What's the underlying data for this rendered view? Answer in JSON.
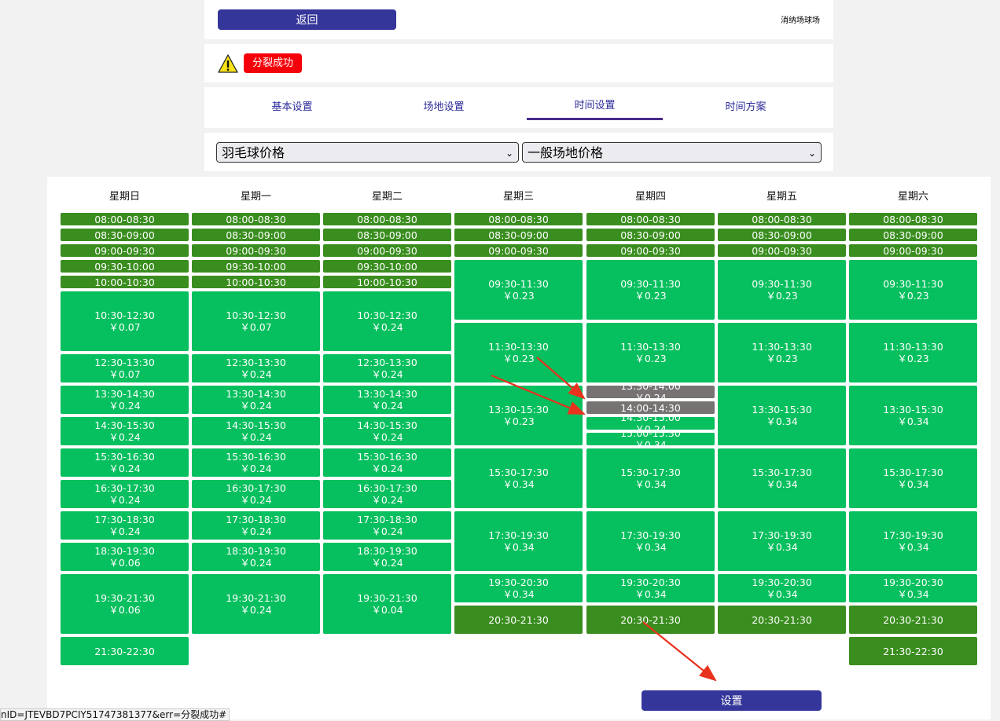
{
  "topbar": {
    "back_label": "返回",
    "venue_name": "消纳场球场"
  },
  "alert": {
    "icon": "warning-icon",
    "message": "分裂成功"
  },
  "tabs": [
    {
      "label": "基本设置",
      "active": false
    },
    {
      "label": "场地设置",
      "active": false
    },
    {
      "label": "时间设置",
      "active": true
    },
    {
      "label": "时间方案",
      "active": false
    }
  ],
  "filters": {
    "sport_select": "羽毛球价格",
    "price_type_select": "一般场地价格"
  },
  "days": [
    {
      "name": "星期日",
      "slots": [
        {
          "time": "08:00-08:30",
          "price": "",
          "style": "dark"
        },
        {
          "time": "08:30-09:00",
          "price": "",
          "style": "dark"
        },
        {
          "time": "09:00-09:30",
          "price": "",
          "style": "dark"
        },
        {
          "time": "09:30-10:00",
          "price": "",
          "style": "dark"
        },
        {
          "time": "10:00-10:30",
          "price": "",
          "style": "dark"
        },
        {
          "time": "10:30-12:30",
          "price": "￥0.07",
          "style": "light"
        },
        {
          "time": "12:30-13:30",
          "price": "￥0.07",
          "style": "light"
        },
        {
          "time": "13:30-14:30",
          "price": "￥0.24",
          "style": "light"
        },
        {
          "time": "14:30-15:30",
          "price": "￥0.24",
          "style": "light"
        },
        {
          "time": "15:30-16:30",
          "price": "￥0.24",
          "style": "light"
        },
        {
          "time": "16:30-17:30",
          "price": "￥0.24",
          "style": "light"
        },
        {
          "time": "17:30-18:30",
          "price": "￥0.24",
          "style": "light"
        },
        {
          "time": "18:30-19:30",
          "price": "￥0.06",
          "style": "light"
        },
        {
          "time": "19:30-21:30",
          "price": "￥0.06",
          "style": "light"
        },
        {
          "time": "21:30-22:30",
          "price": "",
          "style": "light"
        }
      ]
    },
    {
      "name": "星期一",
      "slots": [
        {
          "time": "08:00-08:30",
          "price": "",
          "style": "dark"
        },
        {
          "time": "08:30-09:00",
          "price": "",
          "style": "dark"
        },
        {
          "time": "09:00-09:30",
          "price": "",
          "style": "dark"
        },
        {
          "time": "09:30-10:00",
          "price": "",
          "style": "dark"
        },
        {
          "time": "10:00-10:30",
          "price": "",
          "style": "dark"
        },
        {
          "time": "10:30-12:30",
          "price": "￥0.07",
          "style": "light"
        },
        {
          "time": "12:30-13:30",
          "price": "￥0.24",
          "style": "light"
        },
        {
          "time": "13:30-14:30",
          "price": "￥0.24",
          "style": "light"
        },
        {
          "time": "14:30-15:30",
          "price": "￥0.24",
          "style": "light"
        },
        {
          "time": "15:30-16:30",
          "price": "￥0.24",
          "style": "light"
        },
        {
          "time": "16:30-17:30",
          "price": "￥0.24",
          "style": "light"
        },
        {
          "time": "17:30-18:30",
          "price": "￥0.24",
          "style": "light"
        },
        {
          "time": "18:30-19:30",
          "price": "￥0.24",
          "style": "light"
        },
        {
          "time": "19:30-21:30",
          "price": "￥0.24",
          "style": "light"
        }
      ]
    },
    {
      "name": "星期二",
      "slots": [
        {
          "time": "08:00-08:30",
          "price": "",
          "style": "dark"
        },
        {
          "time": "08:30-09:00",
          "price": "",
          "style": "dark"
        },
        {
          "time": "09:00-09:30",
          "price": "",
          "style": "dark"
        },
        {
          "time": "09:30-10:00",
          "price": "",
          "style": "dark"
        },
        {
          "time": "10:00-10:30",
          "price": "",
          "style": "dark"
        },
        {
          "time": "10:30-12:30",
          "price": "￥0.24",
          "style": "light"
        },
        {
          "time": "12:30-13:30",
          "price": "￥0.24",
          "style": "light"
        },
        {
          "time": "13:30-14:30",
          "price": "￥0.24",
          "style": "light"
        },
        {
          "time": "14:30-15:30",
          "price": "￥0.24",
          "style": "light"
        },
        {
          "time": "15:30-16:30",
          "price": "￥0.24",
          "style": "light"
        },
        {
          "time": "16:30-17:30",
          "price": "￥0.24",
          "style": "light"
        },
        {
          "time": "17:30-18:30",
          "price": "￥0.24",
          "style": "light"
        },
        {
          "time": "18:30-19:30",
          "price": "￥0.24",
          "style": "light"
        },
        {
          "time": "19:30-21:30",
          "price": "￥0.04",
          "style": "light"
        }
      ]
    },
    {
      "name": "星期三",
      "slots": [
        {
          "time": "08:00-08:30",
          "price": "",
          "style": "dark"
        },
        {
          "time": "08:30-09:00",
          "price": "",
          "style": "dark"
        },
        {
          "time": "09:00-09:30",
          "price": "",
          "style": "dark"
        },
        {
          "time": "09:30-11:30",
          "price": "￥0.23",
          "style": "light"
        },
        {
          "time": "11:30-13:30",
          "price": "￥0.23",
          "style": "light"
        },
        {
          "time": "13:30-15:30",
          "price": "￥0.23",
          "style": "light"
        },
        {
          "time": "15:30-17:30",
          "price": "￥0.34",
          "style": "light"
        },
        {
          "time": "17:30-19:30",
          "price": "￥0.34",
          "style": "light"
        },
        {
          "time": "19:30-20:30",
          "price": "￥0.34",
          "style": "light"
        },
        {
          "time": "20:30-21:30",
          "price": "",
          "style": "dark"
        }
      ]
    },
    {
      "name": "星期四",
      "slots": [
        {
          "time": "08:00-08:30",
          "price": "",
          "style": "dark"
        },
        {
          "time": "08:30-09:00",
          "price": "",
          "style": "dark"
        },
        {
          "time": "09:00-09:30",
          "price": "",
          "style": "dark"
        },
        {
          "time": "09:30-11:30",
          "price": "￥0.23",
          "style": "light"
        },
        {
          "time": "11:30-13:30",
          "price": "￥0.23",
          "style": "light"
        },
        {
          "time": "13:30-14:00",
          "price": "￥0.24",
          "style": "gray"
        },
        {
          "time": "14:00-14:30",
          "price": "",
          "style": "gray"
        },
        {
          "time": "14:30-15:00",
          "price": "￥0.24",
          "style": "light"
        },
        {
          "time": "15:00-15:30",
          "price": "￥0.34",
          "style": "light"
        },
        {
          "time": "15:30-17:30",
          "price": "￥0.34",
          "style": "light"
        },
        {
          "time": "17:30-19:30",
          "price": "￥0.34",
          "style": "light"
        },
        {
          "time": "19:30-20:30",
          "price": "￥0.34",
          "style": "light"
        },
        {
          "time": "20:30-21:30",
          "price": "",
          "style": "dark"
        }
      ]
    },
    {
      "name": "星期五",
      "slots": [
        {
          "time": "08:00-08:30",
          "price": "",
          "style": "dark"
        },
        {
          "time": "08:30-09:00",
          "price": "",
          "style": "dark"
        },
        {
          "time": "09:00-09:30",
          "price": "",
          "style": "dark"
        },
        {
          "time": "09:30-11:30",
          "price": "￥0.23",
          "style": "light"
        },
        {
          "time": "11:30-13:30",
          "price": "￥0.23",
          "style": "light"
        },
        {
          "time": "13:30-15:30",
          "price": "￥0.34",
          "style": "light"
        },
        {
          "time": "15:30-17:30",
          "price": "￥0.34",
          "style": "light"
        },
        {
          "time": "17:30-19:30",
          "price": "￥0.34",
          "style": "light"
        },
        {
          "time": "19:30-20:30",
          "price": "￥0.34",
          "style": "light"
        },
        {
          "time": "20:30-21:30",
          "price": "",
          "style": "dark"
        }
      ]
    },
    {
      "name": "星期六",
      "slots": [
        {
          "time": "08:00-08:30",
          "price": "",
          "style": "dark"
        },
        {
          "time": "08:30-09:00",
          "price": "",
          "style": "dark"
        },
        {
          "time": "09:00-09:30",
          "price": "",
          "style": "dark"
        },
        {
          "time": "09:30-11:30",
          "price": "￥0.23",
          "style": "light"
        },
        {
          "time": "11:30-13:30",
          "price": "￥0.23",
          "style": "light"
        },
        {
          "time": "13:30-15:30",
          "price": "￥0.34",
          "style": "light"
        },
        {
          "time": "15:30-17:30",
          "price": "￥0.34",
          "style": "light"
        },
        {
          "time": "17:30-19:30",
          "price": "￥0.34",
          "style": "light"
        },
        {
          "time": "19:30-20:30",
          "price": "￥0.34",
          "style": "light"
        },
        {
          "time": "20:30-21:30",
          "price": "",
          "style": "dark"
        },
        {
          "time": "21:30-22:30",
          "price": "",
          "style": "dark"
        }
      ]
    }
  ],
  "footer": {
    "set_label": "设置"
  },
  "status_url": "nID=JTEVBD7PCIY51747381377&err=分裂成功#",
  "colors": {
    "primary": "#35369a",
    "alert": "#f5000a",
    "slot_dark": "#3a8d1f",
    "slot_light": "#06bf5e",
    "slot_selected": "#777373",
    "annotation_arrow": "#e8321e"
  }
}
